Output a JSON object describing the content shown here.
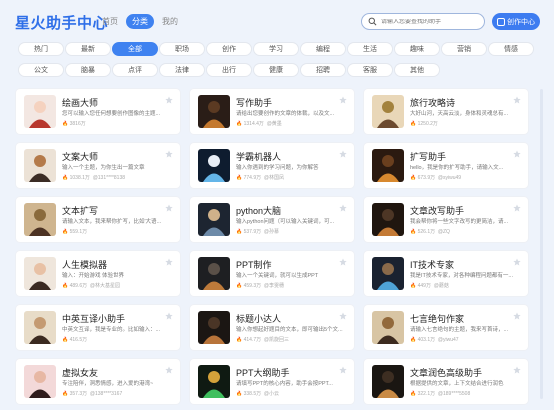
{
  "header": {
    "logo": "星火助手中心",
    "tabs": [
      {
        "label": "首页",
        "active": false
      },
      {
        "label": "分类",
        "active": true
      },
      {
        "label": "我的",
        "active": false
      }
    ],
    "search_placeholder": "请输入您要查找的助手",
    "create_label": "创作中心"
  },
  "categories": {
    "row1": [
      "热门",
      "最新",
      "全部",
      "职场",
      "创作",
      "学习",
      "编程",
      "生活",
      "趣味",
      "营销",
      "情感"
    ],
    "row2": [
      "公文",
      "脑暴",
      "点评",
      "法律",
      "出行",
      "健康",
      "招聘",
      "客服",
      "其他"
    ],
    "active": "全部"
  },
  "cards": [
    {
      "title": "绘画大师",
      "desc": "您可以输入您任何想要创作图像的主题...",
      "views": "3816万",
      "author": "",
      "thumb": "girl-red-hair"
    },
    {
      "title": "写作助手",
      "desc": "请给出您要创作的文章的体裁，以及文...",
      "views": "1314.4万",
      "author": "@黄墨",
      "thumb": "man-desk-night"
    },
    {
      "title": "旅行攻略诗",
      "desc": "大好山河，天高云淡，身体和灵魂总有...",
      "views": "1250.2万",
      "author": "",
      "thumb": "mountain-lake"
    },
    {
      "title": "文案大师",
      "desc": "输入一个主题，为你生出一篇文章",
      "views": "1038.1万",
      "author": "@131****8138",
      "thumb": "man-laptop"
    },
    {
      "title": "学霸机器人",
      "desc": "输入你遇到的学习问题，为你解答",
      "views": "774.9万",
      "author": "@林国凤",
      "thumb": "robot"
    },
    {
      "title": "扩写助手",
      "desc": "hello，我是你的扩写助手，请输入文...",
      "views": "673.9万",
      "author": "@syiwu49",
      "thumb": "man-desk-warm"
    },
    {
      "title": "文本扩写",
      "desc": "请输入文本，我来帮你扩写，比如'大语...",
      "views": "559.1万",
      "author": "",
      "thumb": "man-book"
    },
    {
      "title": "python大脑",
      "desc": "输入python问题（可以输入关键词，可...",
      "views": "537.9万",
      "author": "@孙慕",
      "thumb": "man-computer"
    },
    {
      "title": "文章改写助手",
      "desc": "我会帮你将一些文字改写的更简洁，请...",
      "views": "526.1万",
      "author": "@ZQ",
      "thumb": "man-desk-night2"
    },
    {
      "title": "人生模拟器",
      "desc": "输入：开始游戏 体验世界",
      "views": "489.6万",
      "author": "@林大基星园",
      "thumb": "girl-hair"
    },
    {
      "title": "PPT制作",
      "desc": "输入一个关键词，就可以生成PPT",
      "views": "459.3万",
      "author": "@李雯穗",
      "thumb": "man-office"
    },
    {
      "title": "IT技术专家",
      "desc": "我是IT技术专家，对各种编程问题都有一...",
      "views": "449万",
      "author": "@蘑菇",
      "thumb": "man-monitor"
    },
    {
      "title": "中英互译小助手",
      "desc": "中英文互译，我是专业的。比如输入：...",
      "views": "416.5万",
      "author": "",
      "thumb": "man-glasses"
    },
    {
      "title": "标题小达人",
      "desc": "输入你想起好题目的文本，即可输出5个文...",
      "views": "414.7万",
      "author": "@凯旋回三",
      "thumb": "man-reading"
    },
    {
      "title": "七言绝句作家",
      "desc": "请输入七言绝句的主题，我来写首诗，...",
      "views": "403.1万",
      "author": "@yiwu47",
      "thumb": "man-writing"
    },
    {
      "title": "虚拟女友",
      "desc": "专注陪伴，洞悉情感，进入爱的港湾~",
      "views": "357.3万",
      "author": "@138****3167",
      "thumb": "girl-pink"
    },
    {
      "title": "PPT大纲助手",
      "desc": "请填写PPT的核心内容，助手会按PPT...",
      "views": "338.5万",
      "author": "@小云",
      "thumb": "screens-green"
    },
    {
      "title": "文章润色高级助手",
      "desc": "根据提供的文章，上下文结合进行润色",
      "views": "322.1万",
      "author": "@189****5508",
      "thumb": "man-desk-dark"
    }
  ],
  "colors": {
    "accent": "#3f82f0",
    "logo": "#2f6fe8",
    "background": "#eef3fb",
    "fire": "#f39a3a"
  }
}
